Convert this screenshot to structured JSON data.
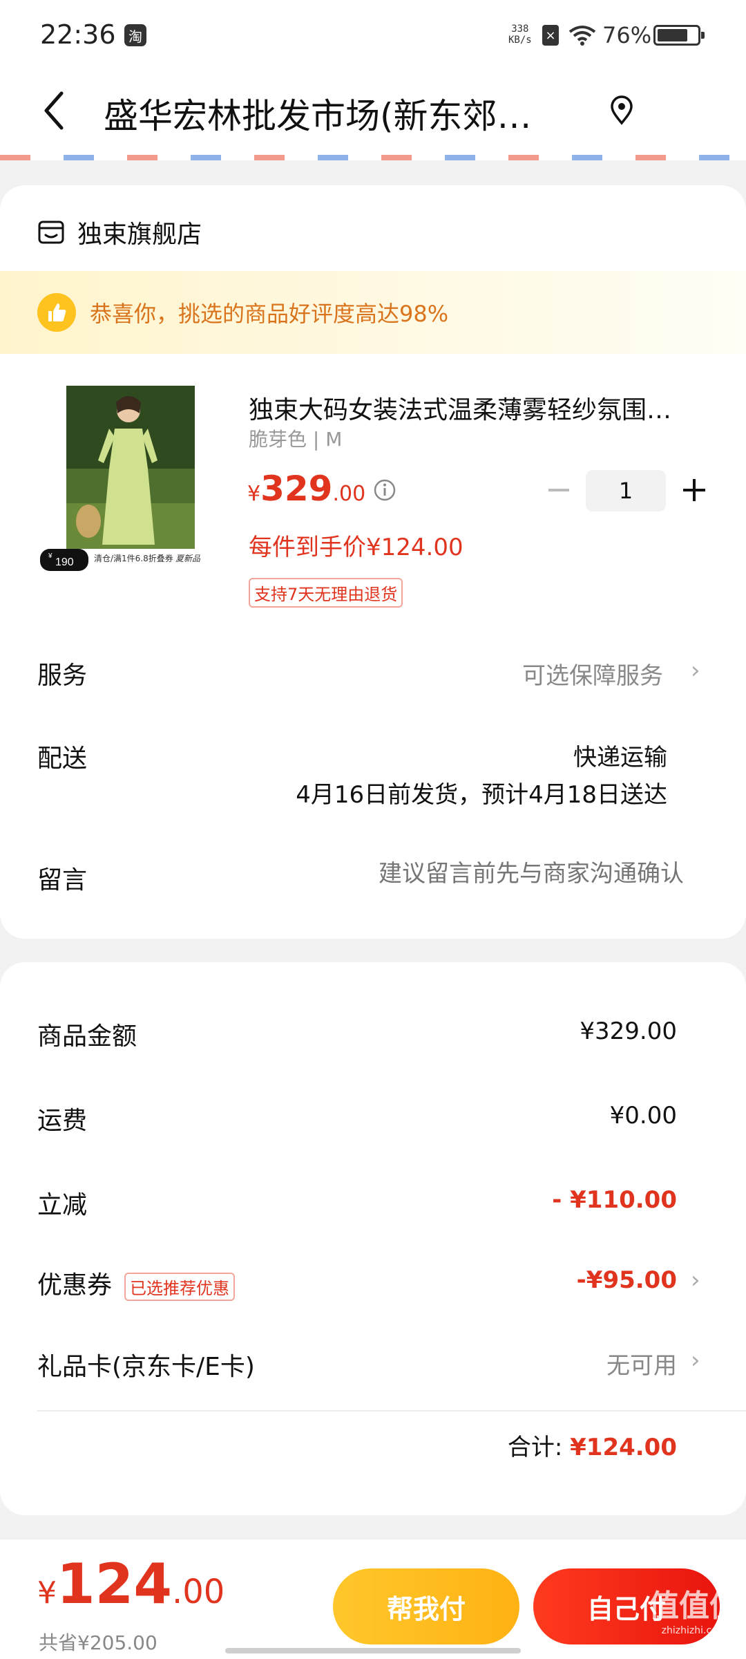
{
  "status_bar": {
    "time": "22:36",
    "app_icon": "淘",
    "net_speed_value": "338",
    "net_speed_unit": "KB/s",
    "battery_percent": "76%",
    "battery_level": 0.76
  },
  "header": {
    "title": "盛华宏林批发市场(新东郊…",
    "back_icon": "chevron-left-icon",
    "location_icon": "location-pin-icon"
  },
  "shop": {
    "name": "独束旗舰店",
    "icon": "store-icon"
  },
  "praise_banner": {
    "text": "恭喜你，挑选的商品好评度高达98%",
    "icon": "thumbs-up-icon"
  },
  "product": {
    "title": "独束大码女装法式温柔薄雾轻纱氛围…",
    "spec": "脆芽色 | M",
    "price_currency": "¥",
    "price_integer": "329",
    "price_decimal": ".00",
    "final_price_text": "每件到手价¥124.00",
    "return_tag": "支持7天无理由退货",
    "quantity": "1",
    "image_badge_price": "190",
    "image_banner_text": "清仓/满1件6.8折叠券",
    "image_new_tag": "夏新品"
  },
  "service": {
    "label": "服务",
    "value": "可选保障服务"
  },
  "delivery": {
    "label": "配送",
    "method": "快递运输",
    "estimate": "4月16日前发货，预计4月18日送达"
  },
  "message": {
    "label": "留言",
    "placeholder": "建议留言前先与商家沟通确认"
  },
  "summary": {
    "goods_label": "商品金额",
    "goods_value": "¥329.00",
    "shipping_label": "运费",
    "shipping_value": "¥0.00",
    "discount_label": "立减",
    "discount_value": "- ¥110.00",
    "coupon_label": "优惠券",
    "coupon_tag": "已选推荐优惠",
    "coupon_value": "-¥95.00",
    "giftcard_label": "礼品卡(京东卡/E卡)",
    "giftcard_value": "无可用",
    "total_label": "合计:",
    "total_value": "¥124.00"
  },
  "bottom_bar": {
    "price_currency": "¥",
    "price_integer": "124",
    "price_decimal": ".00",
    "saved_text": "共省¥205.00",
    "help_pay_label": "帮我付",
    "self_pay_label": "自己付"
  },
  "watermark": {
    "logo": "值值值",
    "site": "zhizhizhi.com"
  },
  "colors": {
    "accent_red": "#e0341f",
    "praise_orange": "#d9741c",
    "help_button": "#ffbd20",
    "self_button": "#f0220f"
  }
}
